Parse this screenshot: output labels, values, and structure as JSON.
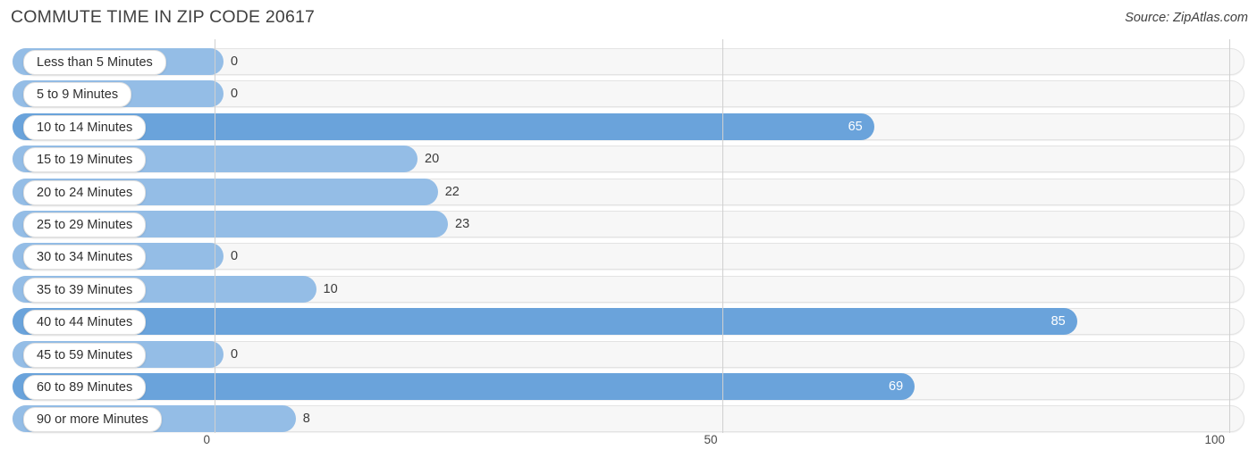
{
  "header": {
    "title": "COMMUTE TIME IN ZIP CODE 20617",
    "source": "Source: ZipAtlas.com"
  },
  "chart_data": {
    "type": "bar",
    "orientation": "horizontal",
    "title": "COMMUTE TIME IN ZIP CODE 20617",
    "subtitle": "Source: ZipAtlas.com",
    "xlabel": "",
    "ylabel": "",
    "xlim": [
      0,
      100
    ],
    "xticks": [
      "0",
      "50",
      "100"
    ],
    "xtick_values": [
      0,
      50,
      100
    ],
    "grid": true,
    "legend": false,
    "categories": [
      "Less than 5 Minutes",
      "5 to 9 Minutes",
      "10 to 14 Minutes",
      "15 to 19 Minutes",
      "20 to 24 Minutes",
      "25 to 29 Minutes",
      "30 to 34 Minutes",
      "35 to 39 Minutes",
      "40 to 44 Minutes",
      "45 to 59 Minutes",
      "60 to 89 Minutes",
      "90 or more Minutes"
    ],
    "values": [
      0,
      0,
      65,
      20,
      22,
      23,
      0,
      10,
      85,
      0,
      69,
      8
    ],
    "value_labels": [
      "0",
      "0",
      "65",
      "20",
      "22",
      "23",
      "0",
      "10",
      "85",
      "0",
      "69",
      "8"
    ]
  },
  "colors": {
    "bar_light": "#94bde6",
    "bar_dark": "#6aa3db",
    "track": "#f7f7f7",
    "grid": "#d0d0d0",
    "label_text": "#2f2f2f",
    "value_inside": "#ffffff"
  },
  "rows": [
    {
      "label": "Less than 5 Minutes",
      "value": 0,
      "value_label": "0",
      "shade": "light",
      "label_inside": true
    },
    {
      "label": "5 to 9 Minutes",
      "value": 0,
      "value_label": "0",
      "shade": "light",
      "label_inside": true
    },
    {
      "label": "10 to 14 Minutes",
      "value": 65,
      "value_label": "65",
      "shade": "dark",
      "label_inside": true
    },
    {
      "label": "15 to 19 Minutes",
      "value": 20,
      "value_label": "20",
      "shade": "light",
      "label_inside": false
    },
    {
      "label": "20 to 24 Minutes",
      "value": 22,
      "value_label": "22",
      "shade": "light",
      "label_inside": false
    },
    {
      "label": "25 to 29 Minutes",
      "value": 23,
      "value_label": "23",
      "shade": "light",
      "label_inside": false
    },
    {
      "label": "30 to 34 Minutes",
      "value": 0,
      "value_label": "0",
      "shade": "light",
      "label_inside": true
    },
    {
      "label": "35 to 39 Minutes",
      "value": 10,
      "value_label": "10",
      "shade": "light",
      "label_inside": false
    },
    {
      "label": "40 to 44 Minutes",
      "value": 85,
      "value_label": "85",
      "shade": "dark",
      "label_inside": true
    },
    {
      "label": "45 to 59 Minutes",
      "value": 0,
      "value_label": "0",
      "shade": "light",
      "label_inside": true
    },
    {
      "label": "60 to 89 Minutes",
      "value": 69,
      "value_label": "69",
      "shade": "dark",
      "label_inside": true
    },
    {
      "label": "90 or more Minutes",
      "value": 8,
      "value_label": "8",
      "shade": "light",
      "label_inside": false
    }
  ],
  "axis": {
    "ticks": [
      "0",
      "50",
      "100"
    ]
  }
}
